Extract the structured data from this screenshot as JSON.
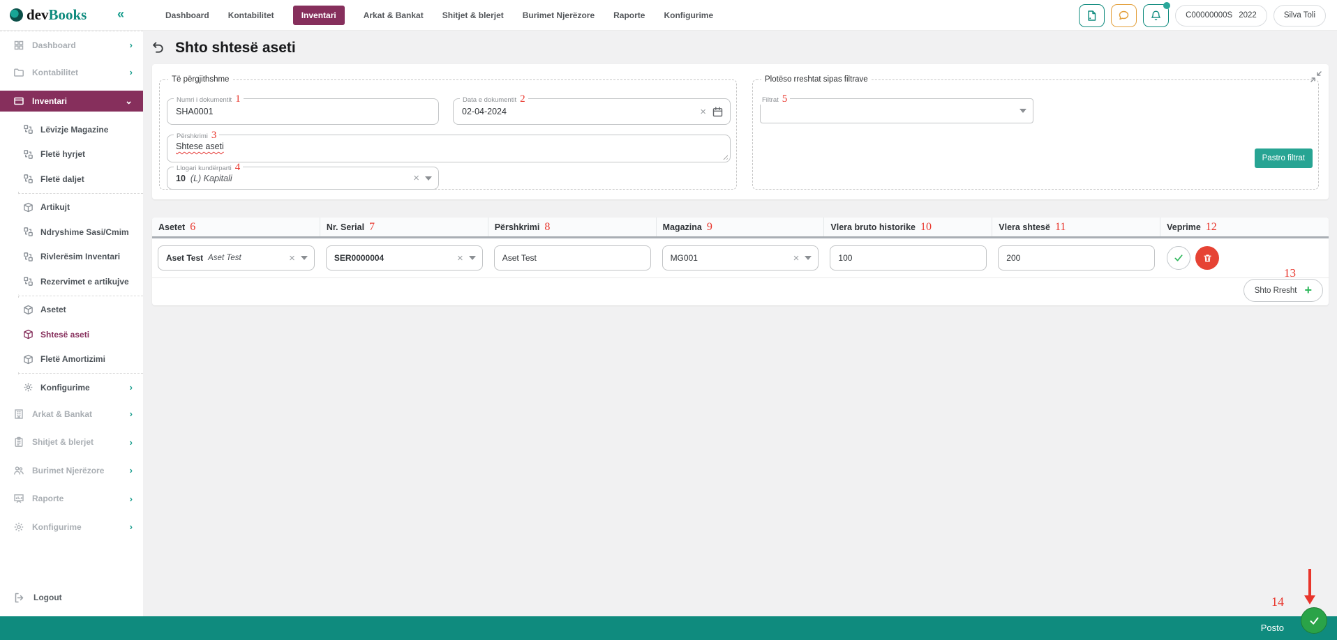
{
  "topbar": {
    "logo_dev": "dev",
    "logo_books": "Books",
    "collapse_icon": "«",
    "nav": [
      {
        "label": "Dashboard",
        "active": false
      },
      {
        "label": "Kontabilitet",
        "active": false
      },
      {
        "label": "Inventari",
        "active": true
      },
      {
        "label": "Arkat & Bankat",
        "active": false
      },
      {
        "label": "Shitjet & blerjet",
        "active": false
      },
      {
        "label": "Burimet Njerëzore",
        "active": false
      },
      {
        "label": "Raporte",
        "active": false
      },
      {
        "label": "Konfigurime",
        "active": false
      }
    ],
    "company_code": "C00000000S",
    "fiscal_year": "2022",
    "user_name": "Silva Toli"
  },
  "sidebar": {
    "items": [
      {
        "label": "Dashboard"
      },
      {
        "label": "Kontabilitet"
      },
      {
        "label": "Inventari",
        "active": true
      },
      {
        "label": "Lëvizje Magazine"
      },
      {
        "label": "Fletë hyrjet"
      },
      {
        "label": "Fletë daljet"
      },
      {
        "label": "Artikujt"
      },
      {
        "label": "Ndryshime Sasi/Cmim"
      },
      {
        "label": "Rivlerësim Inventari"
      },
      {
        "label": "Rezervimet e artikujve"
      },
      {
        "label": "Asetet"
      },
      {
        "label": "Shtesë aseti",
        "active": true
      },
      {
        "label": "Fletë Amortizimi"
      },
      {
        "label": "Konfigurime"
      },
      {
        "label": "Arkat & Bankat"
      },
      {
        "label": "Shitjet & blerjet"
      },
      {
        "label": "Burimet Njerëzore"
      },
      {
        "label": "Raporte"
      },
      {
        "label": "Konfigurime"
      },
      {
        "label": "Logout"
      }
    ]
  },
  "page": {
    "title": "Shto shtesë aseti"
  },
  "general": {
    "legend": "Të përgjithshme",
    "doc_number_label": "Numri i dokumentit",
    "doc_number_value": "SHA0001",
    "doc_date_label": "Data e dokumentit",
    "doc_date_value": "02-04-2024",
    "description_label": "Përshkrimi",
    "description_value": "Shtese aseti",
    "counter_account_label": "Llogari kundërparti",
    "counter_account_code": "10",
    "counter_account_name": "(L) Kapitali"
  },
  "filters": {
    "legend": "Plotëso rreshtat sipas filtrave",
    "filter_label": "Filtrat",
    "filter_value": "",
    "clear_button_label": "Pastro filtrat"
  },
  "table": {
    "headers": [
      "Asetet",
      "Nr. Serial",
      "Përshkrimi",
      "Magazina",
      "Vlera bruto historike",
      "Vlera shtesë",
      "Veprime"
    ],
    "row": {
      "asset_code": "Aset Test",
      "asset_name": "Aset Test",
      "serial_number": "SER0000004",
      "description": "Aset Test",
      "warehouse": "MG001",
      "gross_historical_value": "100",
      "addition_value": "200"
    },
    "add_row_label": "Shto Rresht"
  },
  "footer": {
    "post_label": "Posto"
  },
  "annotations": [
    "1",
    "2",
    "3",
    "4",
    "5",
    "6",
    "7",
    "8",
    "9",
    "10",
    "11",
    "12",
    "13",
    "14"
  ],
  "colors": {
    "accent_teal": "#0f8b7e",
    "accent_purple": "#862f5c",
    "button_teal": "#27a493",
    "annotation_red": "#e8352b",
    "danger_red": "#e64334",
    "success_green": "#2eb85c",
    "chat_orange": "#e3a03c"
  }
}
